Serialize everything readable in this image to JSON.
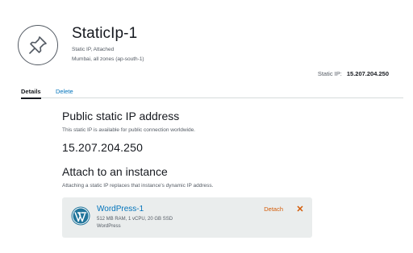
{
  "header": {
    "title": "StaticIp-1",
    "status": "Static IP, Attached",
    "location": "Mumbai, all zones (ap-south-1)",
    "icon": "pin-icon",
    "static_ip_label": "Static IP:",
    "static_ip_value": "15.207.204.250"
  },
  "tabs": [
    {
      "label": "Details",
      "active": true
    },
    {
      "label": "Delete",
      "active": false
    }
  ],
  "public_ip": {
    "title": "Public static IP address",
    "description": "This static IP is available for public connection worldwide.",
    "address": "15.207.204.250"
  },
  "attach": {
    "title": "Attach to an instance",
    "description": "Attaching a static IP replaces that instance's dynamic IP address.",
    "instance": {
      "name": "WordPress-1",
      "specs": "512 MB RAM, 1 vCPU, 20 GB SSD",
      "blueprint": "WordPress",
      "icon": "wordpress-logo",
      "detach_label": "Detach",
      "detach_icon": "close-icon"
    }
  },
  "colors": {
    "link": "#0073bb",
    "accent": "#d45b07",
    "card_bg": "#eaeded",
    "text": "#16191f",
    "muted": "#545b64"
  }
}
